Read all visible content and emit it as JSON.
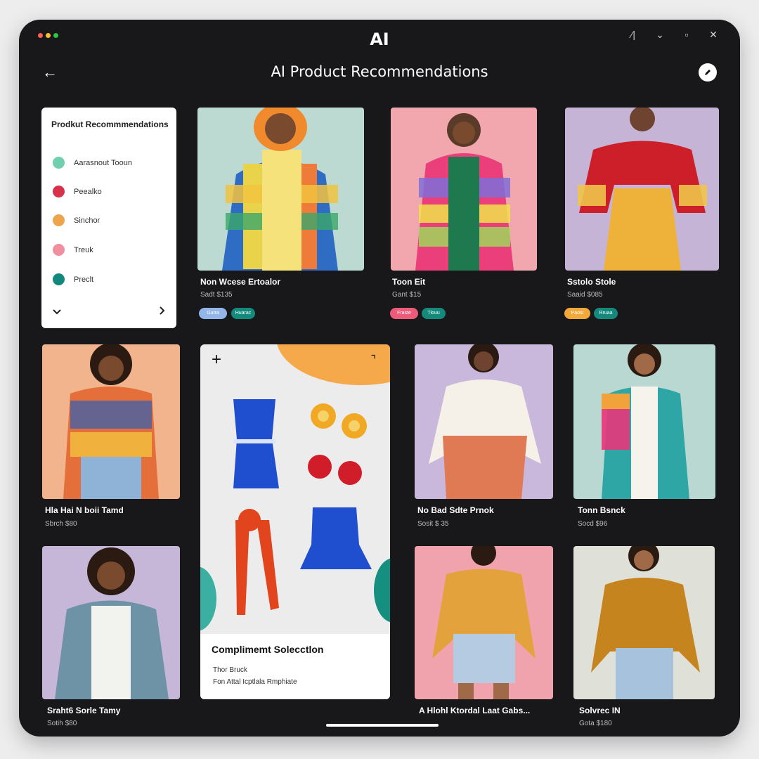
{
  "window": {
    "app_title": "AI",
    "dots": [
      "#ff5f57",
      "#febc2e",
      "#28c840"
    ]
  },
  "header": {
    "title": "AI Product Recommendations"
  },
  "filters": {
    "title": "Prodkut Recommmendations",
    "items": [
      {
        "label": "Aarasnout Tooun",
        "color": "#6fcfae"
      },
      {
        "label": "Peealko",
        "color": "#d8324a"
      },
      {
        "label": "Sinchor",
        "color": "#eea44a"
      },
      {
        "label": "Treuk",
        "color": "#ef8fa0"
      },
      {
        "label": "Preclt",
        "color": "#14877c"
      }
    ]
  },
  "products": [
    {
      "name": "Non Wcese Ertoalor",
      "price": "Sadt $135",
      "chips": [
        "Gutra",
        "Huarac"
      ],
      "chip_colors": [
        "#93b6e8",
        "#138a7c"
      ]
    },
    {
      "name": "Toon Eit",
      "price": "Gant $15",
      "chips": [
        "Fraste",
        "Tlouu"
      ],
      "chip_colors": [
        "#ec5b79",
        "#138a7c"
      ]
    },
    {
      "name": "Sstolo Stole",
      "price": "Saaid $085",
      "chips": [
        "Paost",
        "Rruaa"
      ],
      "chip_colors": [
        "#f3a93a",
        "#138a7c"
      ]
    },
    {
      "name": "Hla Hai N boii Tamd",
      "price": "Sbrch $80",
      "chips": [],
      "chip_colors": []
    },
    {
      "name": "No Bad Sdte Prnok",
      "price": "Sosit $ 35",
      "chips": [],
      "chip_colors": []
    },
    {
      "name": "Tonn Bsnck",
      "price": "Socd $96",
      "chips": [],
      "chip_colors": []
    },
    {
      "name": "Sraht6 Sorle Tamy",
      "price": "Sotih $80",
      "chips": [],
      "chip_colors": []
    },
    {
      "name": "A Hlohl Ktordal Laat Gabs...",
      "price": "",
      "chips": [],
      "chip_colors": []
    },
    {
      "name": "Solvrec IN",
      "price": "Gota $180",
      "chips": [],
      "chip_colors": []
    }
  ],
  "complement": {
    "title": "Complimemt Solecctlon",
    "subtitle": "Thor Bruck",
    "description": "Fon Attal Icptlala Rmphiate"
  }
}
